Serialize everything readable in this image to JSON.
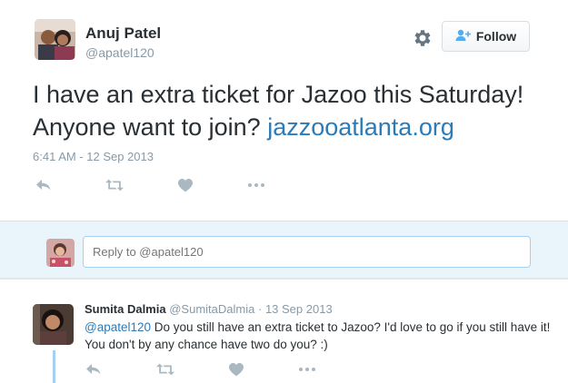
{
  "tweet": {
    "author_name": "Anuj Patel",
    "author_handle": "@apatel120",
    "text": "I have an extra ticket for Jazoo this Saturday! Anyone want to join?",
    "link": "jazzooatlanta.org",
    "timestamp": "6:41 AM - 12 Sep 2013",
    "follow_label": "Follow"
  },
  "reply_box": {
    "placeholder": "Reply to @apatel120"
  },
  "reply": {
    "author_name": "Sumita Dalmia",
    "author_handle": "@SumitaDalmia",
    "separator": "·",
    "date": "13 Sep 2013",
    "mention": "@apatel120",
    "text": "Do you still have an extra ticket to Jazoo? I'd love to go if you still have it! You don't by any chance have two do you? :)"
  },
  "icons": {
    "reply": "reply-icon",
    "retweet": "retweet-icon",
    "like": "heart-icon",
    "more": "more-icon",
    "settings": "gear-icon",
    "follow": "add-user-icon"
  },
  "colors": {
    "link": "#2b7bb9",
    "muted": "#8899a6",
    "reply_bg": "#eaf4fb",
    "action_icon": "#aab8c2"
  }
}
